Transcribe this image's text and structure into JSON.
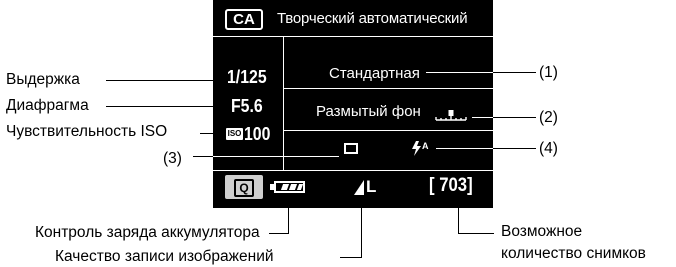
{
  "screen": {
    "mode_badge": "CA",
    "mode_title": "Творческий автоматический",
    "shutter": "1/125",
    "aperture": "F5.6",
    "iso_prefix": "ISO",
    "iso_value": "100",
    "picture_style": "Стандартная",
    "background_blur": "Размытый фон",
    "quick_button": "Q",
    "quality": "L",
    "shots_remaining": "[ 703]"
  },
  "callouts": {
    "shutter": "Выдержка",
    "aperture": "Диафрагма",
    "iso": "Чувствительность ISO",
    "n1": "(1)",
    "n2": "(2)",
    "n3": "(3)",
    "n4": "(4)",
    "battery": "Контроль заряда аккумулятора",
    "quality": "Качество записи изображений",
    "shots_line1": "Возможное",
    "shots_line2": "количество снимков"
  }
}
